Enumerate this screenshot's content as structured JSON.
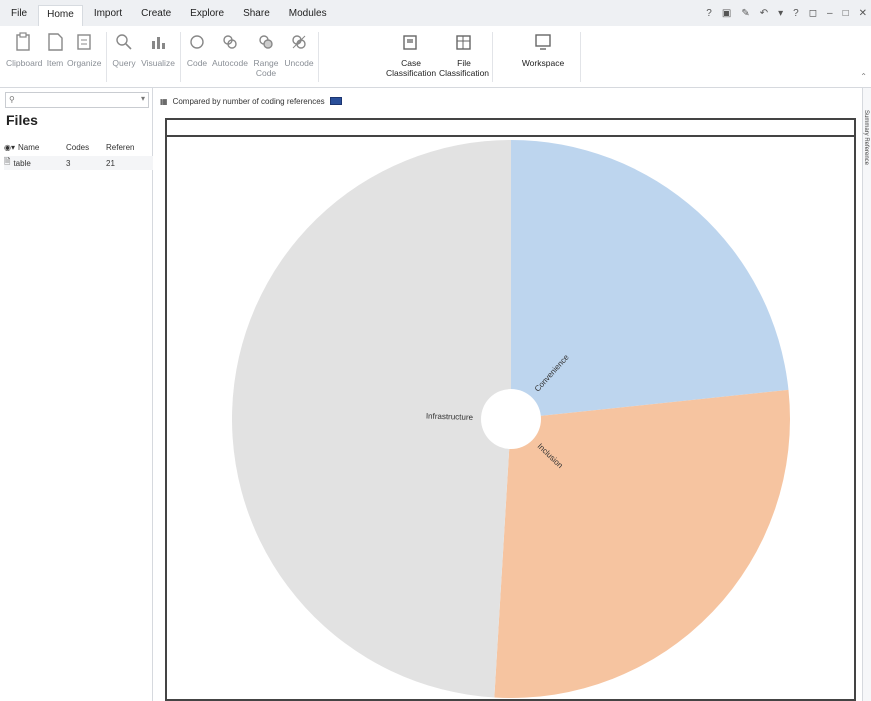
{
  "menu": {
    "file": "File",
    "home": "Home",
    "import": "Import",
    "create": "Create",
    "explore": "Explore",
    "share": "Share",
    "modules": "Modules"
  },
  "ribbon": {
    "clipboard": "Clipboard",
    "item": "Item",
    "organize": "Organize",
    "query": "Query",
    "visualize": "Visualize",
    "code": "Code",
    "autocode": "Autocode",
    "range_code_1": "Range",
    "range_code_2": "Code",
    "uncode": "Uncode",
    "case_1": "Case",
    "case_2": "Classification",
    "file_1": "File",
    "file_2": "Classification",
    "workspace": "Workspace"
  },
  "files_panel": {
    "search_placeholder": "",
    "title": "Files",
    "columns": [
      "Name",
      "Codes",
      "Referen"
    ],
    "rows": [
      {
        "name": "table",
        "codes": "3",
        "refs": "21"
      }
    ]
  },
  "chart_toolbar": {
    "label": "Compared by number of coding references"
  },
  "right_edge": {
    "label": "Summary  Reference"
  },
  "colors": {
    "convenience": "#bdd5ee",
    "inclusion": "#f6c4a0",
    "infrastructure": "#e2e2e2"
  },
  "chart_data": {
    "type": "pie",
    "title": "",
    "donut_hole": true,
    "slices": [
      {
        "label": "Convenience",
        "value": 4.9,
        "color": "#bdd5ee"
      },
      {
        "label": "Inclusion",
        "value": 5.8,
        "color": "#f6c4a0"
      },
      {
        "label": "Infrastructure",
        "value": 10.3,
        "color": "#e2e2e2"
      }
    ]
  }
}
